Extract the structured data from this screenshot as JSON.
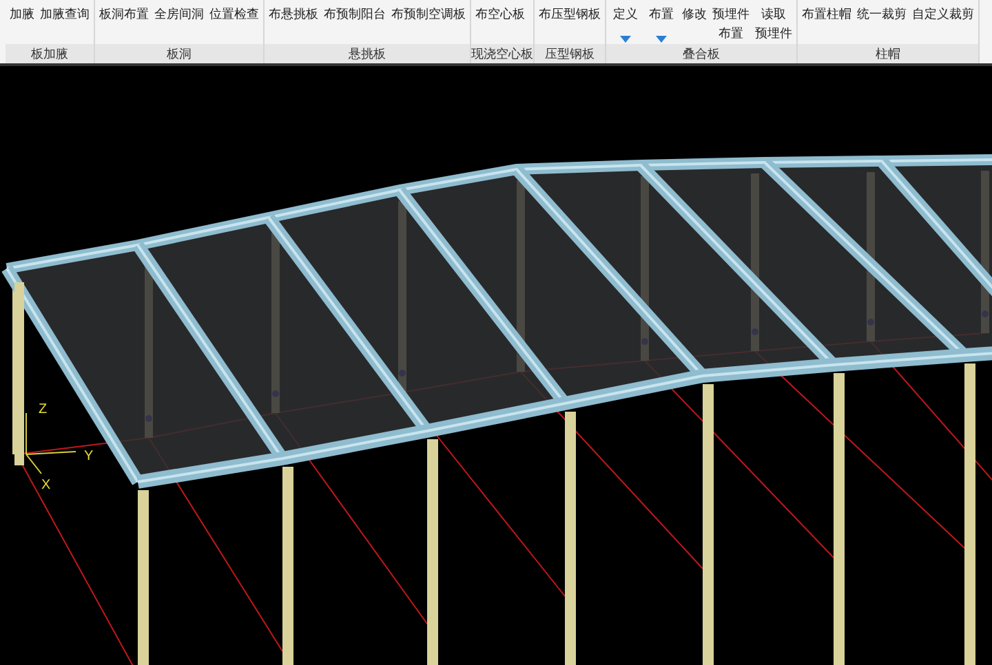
{
  "ribbon": {
    "groups": [
      {
        "label": "板加腋",
        "buttons": [
          {
            "kind": "button",
            "lines": [
              "加腋"
            ]
          },
          {
            "kind": "button",
            "lines": [
              "加腋查询"
            ]
          }
        ]
      },
      {
        "label": "板洞",
        "buttons": [
          {
            "kind": "button",
            "lines": [
              "板洞布置"
            ]
          },
          {
            "kind": "button",
            "lines": [
              "全房间洞"
            ]
          },
          {
            "kind": "button",
            "lines": [
              "位置检查"
            ]
          }
        ]
      },
      {
        "label": "悬挑板",
        "buttons": [
          {
            "kind": "button",
            "lines": [
              "布悬挑板"
            ]
          },
          {
            "kind": "button",
            "lines": [
              "布预制阳台"
            ]
          },
          {
            "kind": "button",
            "lines": [
              "布预制空调板"
            ]
          }
        ]
      },
      {
        "label": "现浇空心板",
        "buttons": [
          {
            "kind": "button",
            "lines": [
              "布空心板"
            ]
          }
        ]
      },
      {
        "label": "压型钢板",
        "buttons": [
          {
            "kind": "button",
            "lines": [
              "布压型钢板"
            ]
          }
        ]
      },
      {
        "label": "叠合板",
        "buttons": [
          {
            "kind": "dropdown",
            "lines": [
              "定义"
            ]
          },
          {
            "kind": "dropdown",
            "lines": [
              "布置"
            ]
          },
          {
            "kind": "button",
            "lines": [
              "修改"
            ]
          },
          {
            "kind": "stacked",
            "lines": [
              "预埋件",
              "布置"
            ]
          },
          {
            "kind": "stacked",
            "lines": [
              "读取",
              "预埋件"
            ]
          }
        ]
      },
      {
        "label": "柱帽",
        "buttons": [
          {
            "kind": "button",
            "lines": [
              "布置柱帽"
            ]
          },
          {
            "kind": "button",
            "lines": [
              "统一裁剪"
            ]
          },
          {
            "kind": "button",
            "lines": [
              "自定义裁剪"
            ]
          }
        ]
      }
    ]
  },
  "viewport": {
    "axis_labels": [
      "Z",
      "Y",
      "X"
    ]
  }
}
